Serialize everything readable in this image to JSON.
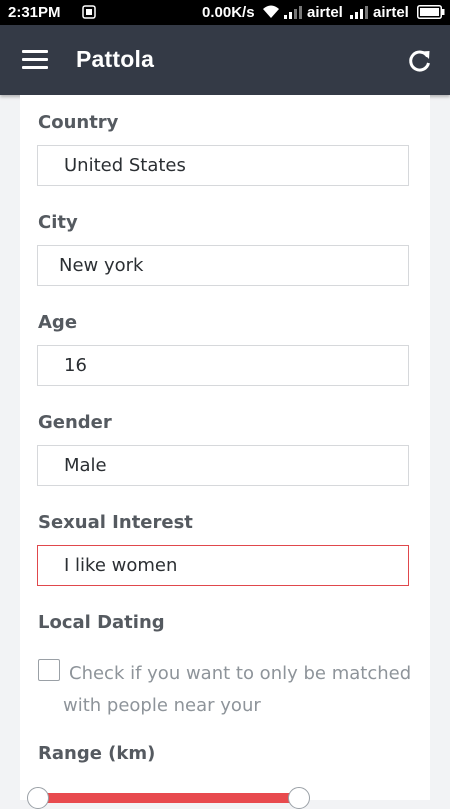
{
  "status_bar": {
    "time": "2:31PM",
    "network_speed": "0.00K/s",
    "carrier_1": "airtel",
    "carrier_2": "airtel"
  },
  "app_bar": {
    "title": "Pattola",
    "menu_icon": "hamburger-menu-icon",
    "refresh_icon": "refresh-icon"
  },
  "form": {
    "country": {
      "label": "Country",
      "value": "United States"
    },
    "city": {
      "label": "City",
      "value": "New york"
    },
    "age": {
      "label": "Age",
      "value": "16"
    },
    "gender": {
      "label": "Gender",
      "value": "Male"
    },
    "sexual_interest": {
      "label": "Sexual Interest",
      "value": "I like women"
    },
    "local_dating": {
      "label": "Local Dating",
      "checkbox_text": "Check if you want to only be matched with people near your",
      "checked": false
    },
    "range": {
      "label": "Range (km)"
    }
  },
  "colors": {
    "app_bar": "#343a46",
    "accent": "#e84a4e",
    "error_border": "#e0484c"
  }
}
